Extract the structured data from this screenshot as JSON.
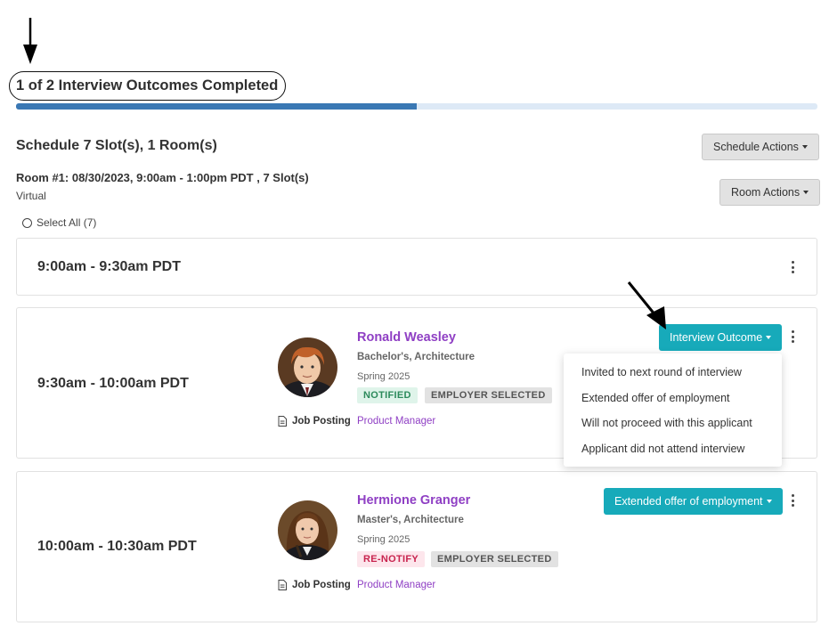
{
  "progress": {
    "label": "1 of 2 Interview Outcomes Completed",
    "completed": 1,
    "total": 2,
    "fraction": 0.5
  },
  "schedule": {
    "title": "Schedule 7 Slot(s), 1 Room(s)",
    "actions_label": "Schedule Actions"
  },
  "room": {
    "title": "Room #1: 08/30/2023, 9:00am - 1:00pm PDT , 7 Slot(s)",
    "location": "Virtual",
    "actions_label": "Room Actions"
  },
  "select_all_label": "Select All (7)",
  "slots": [
    {
      "time": "9:00am - 9:30am PDT"
    },
    {
      "time": "9:30am - 10:00am PDT",
      "name": "Ronald Weasley",
      "degree": "Bachelor's, Architecture",
      "term": "Spring 2025",
      "badges": [
        "NOTIFIED",
        "EMPLOYER SELECTED"
      ],
      "job_posting_label": "Job Posting",
      "job_posting_link": "Product Manager",
      "outcome_button": "Interview Outcome"
    },
    {
      "time": "10:00am - 10:30am PDT",
      "name": "Hermione Granger",
      "degree": "Master's, Architecture",
      "term": "Spring 2025",
      "badges": [
        "RE-NOTIFY",
        "EMPLOYER SELECTED"
      ],
      "job_posting_label": "Job Posting",
      "job_posting_link": "Product Manager",
      "outcome_button": "Extended offer of employment"
    }
  ],
  "outcome_menu": [
    "Invited to next round of interview",
    "Extended offer of employment",
    "Will not proceed with this applicant",
    "Applicant did not attend interview"
  ],
  "colors": {
    "accent_teal": "#17aaba",
    "progress_fill": "#3a78b4",
    "link_purple": "#8f3fc4",
    "badge_green": "#2c8a5b",
    "badge_red": "#c8234e"
  },
  "icons": {
    "annotation": "arrow-icon",
    "more": "kebab-icon",
    "job_posting": "document-icon",
    "dropdown": "caret-down-icon"
  }
}
